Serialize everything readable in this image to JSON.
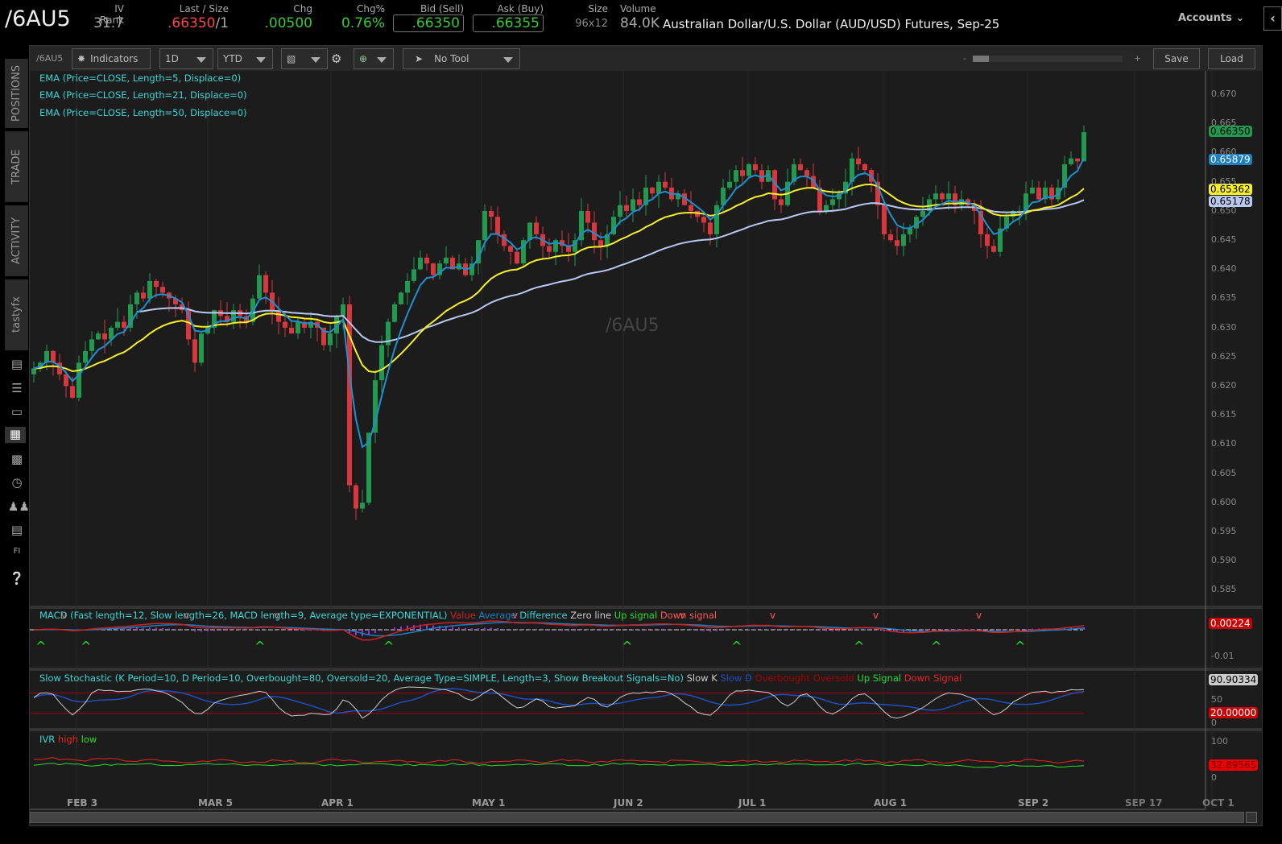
{
  "header": {
    "symbol": "/6AU5",
    "iv_rank_label": "IV Rank",
    "iv_rank": "31.7",
    "last_label": "Last / Size",
    "last": ".66350",
    "size": "/1",
    "chg_label": "Chg",
    "chg": ".00500",
    "chgpct_label": "Chg%",
    "chgpct": "0.76%",
    "bid_label": "Bid (Sell)",
    "bid": ".66350",
    "ask_label": "Ask (Buy)",
    "ask": ".66355",
    "sz_label": "Size",
    "sz": "96x12",
    "vol_label": "Volume",
    "vol": "84.0K",
    "description": "Australian Dollar/U.S. Dollar (AUD/USD) Futures, Sep-25",
    "accounts": "Accounts"
  },
  "toolbar": {
    "symbol": "/6AU5",
    "indicators": "Indicators",
    "aggregation": "1D",
    "range": "YTD",
    "tool": "No Tool",
    "zoom_minus": "-",
    "zoom_plus": "+",
    "save": "Save",
    "load": "Load"
  },
  "sidebar": {
    "tabs": [
      "POSITIONS",
      "TRADE",
      "ACTIVITY",
      "tastyfx"
    ]
  },
  "studies": [
    "EMA (Price=CLOSE, Length=5, Displace=0)",
    "EMA (Price=CLOSE, Length=21, Displace=0)",
    "EMA (Price=CLOSE, Length=50, Displace=0)"
  ],
  "watermark": "/6AU5",
  "price_axis": {
    "ticks": [
      "0.670",
      "0.665",
      "0.660",
      "0.655",
      "0.650",
      "0.645",
      "0.640",
      "0.635",
      "0.630",
      "0.625",
      "0.620",
      "0.615",
      "0.610",
      "0.605",
      "0.600",
      "0.595",
      "0.590",
      "0.585"
    ],
    "tags": {
      "last": "0.66350",
      "ema5": "0.65879",
      "ema21": "0.65362",
      "ema50": "0.65178"
    }
  },
  "macd": {
    "title": "MACD (Fast length=12, Slow length=26, MACD length=9, Average type=EXPONENTIAL)",
    "legend": [
      "Value",
      "Average",
      "Difference",
      "Zero line",
      "Up signal",
      "Down signal"
    ],
    "tick": "-0.01",
    "tag": "0.00224"
  },
  "stoch": {
    "title": "Slow Stochastic (K Period=10, D Period=10, Overbought=80, Oversold=20, Average Type=SIMPLE, Length=3, Show Breakout Signals=No)",
    "legend": [
      "Slow K",
      "Slow D",
      "Overbought",
      "Oversold",
      "Up Signal",
      "Down Signal"
    ],
    "ticks": [
      "50",
      "0"
    ],
    "tag_k": "90.90334",
    "tag_os": "20.00000"
  },
  "ivr": {
    "title": "IVR",
    "legend": [
      "high",
      "low"
    ],
    "ticks": [
      "100",
      "0"
    ],
    "tag": "32.89565"
  },
  "dates": [
    "FEB 3",
    "MAR 5",
    "APR 1",
    "MAY 1",
    "JUN 2",
    "JUL 1",
    "AUG 1",
    "SEP 2",
    "SEP 17",
    "OCT 1"
  ],
  "colors": {
    "up": "#1f9a4f",
    "down": "#d9363e",
    "ema5": "#1e90d0",
    "ema21": "#f5ee2a",
    "ema50": "#b8c8ee",
    "study": "#3bd5d5"
  },
  "chart_data": {
    "type": "candlestick",
    "title": "/6AU5",
    "ylim": [
      0.583,
      0.672
    ],
    "closes": [
      0.623,
      0.624,
      0.626,
      0.624,
      0.622,
      0.62,
      0.618,
      0.624,
      0.626,
      0.628,
      0.629,
      0.628,
      0.63,
      0.631,
      0.63,
      0.634,
      0.636,
      0.635,
      0.638,
      0.637,
      0.636,
      0.635,
      0.634,
      0.633,
      0.628,
      0.624,
      0.629,
      0.63,
      0.633,
      0.632,
      0.631,
      0.633,
      0.632,
      0.631,
      0.635,
      0.639,
      0.636,
      0.633,
      0.631,
      0.63,
      0.629,
      0.631,
      0.63,
      0.631,
      0.63,
      0.627,
      0.629,
      0.632,
      0.634,
      0.603,
      0.599,
      0.6,
      0.612,
      0.621,
      0.627,
      0.631,
      0.634,
      0.636,
      0.638,
      0.64,
      0.642,
      0.641,
      0.639,
      0.641,
      0.642,
      0.64,
      0.641,
      0.639,
      0.641,
      0.645,
      0.65,
      0.649,
      0.646,
      0.644,
      0.643,
      0.641,
      0.645,
      0.648,
      0.646,
      0.644,
      0.643,
      0.645,
      0.644,
      0.643,
      0.645,
      0.65,
      0.648,
      0.645,
      0.644,
      0.646,
      0.649,
      0.651,
      0.65,
      0.652,
      0.651,
      0.654,
      0.653,
      0.655,
      0.654,
      0.652,
      0.653,
      0.651,
      0.65,
      0.649,
      0.648,
      0.646,
      0.651,
      0.654,
      0.655,
      0.657,
      0.656,
      0.658,
      0.657,
      0.655,
      0.657,
      0.652,
      0.651,
      0.655,
      0.658,
      0.657,
      0.656,
      0.654,
      0.65,
      0.651,
      0.652,
      0.653,
      0.655,
      0.659,
      0.658,
      0.657,
      0.655,
      0.651,
      0.646,
      0.645,
      0.644,
      0.646,
      0.647,
      0.649,
      0.65,
      0.652,
      0.653,
      0.652,
      0.653,
      0.651,
      0.652,
      0.651,
      0.65,
      0.646,
      0.644,
      0.643,
      0.647,
      0.649,
      0.65,
      0.65,
      0.653,
      0.654,
      0.652,
      0.654,
      0.652,
      0.654,
      0.658,
      0.659,
      0.6585,
      0.6635
    ]
  }
}
